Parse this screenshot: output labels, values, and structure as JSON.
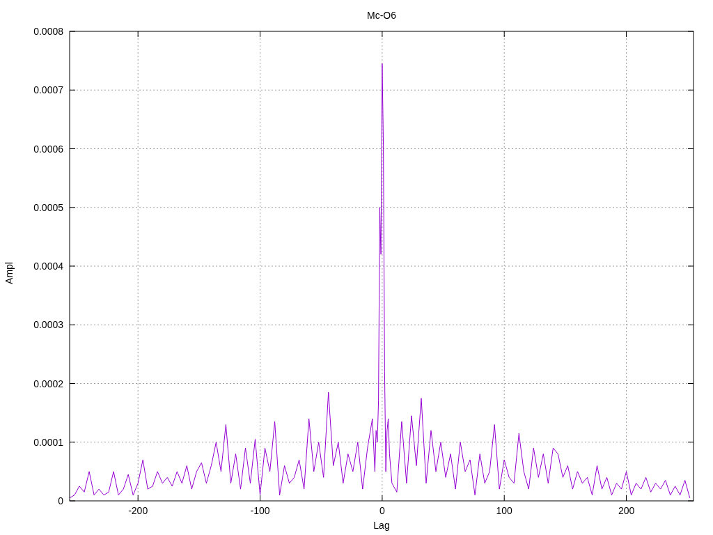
{
  "chart": {
    "chart_data": {
      "type": "line",
      "title": "Mc-O6",
      "xlabel": "Lag",
      "ylabel": "Ampl",
      "grid": true,
      "xlim": [
        -256,
        255
      ],
      "ylim": [
        0,
        0.0008
      ],
      "xticks": [
        -200,
        -100,
        0,
        100,
        200
      ],
      "yticks": [
        0,
        0.0001,
        0.0002,
        0.0003,
        0.0004,
        0.0005,
        0.0006,
        0.0007,
        0.0008
      ],
      "x": [
        -256,
        -252,
        -248,
        -244,
        -240,
        -236,
        -232,
        -228,
        -224,
        -220,
        -216,
        -212,
        -208,
        -204,
        -200,
        -196,
        -192,
        -188,
        -184,
        -180,
        -176,
        -172,
        -168,
        -164,
        -160,
        -156,
        -152,
        -148,
        -144,
        -140,
        -136,
        -132,
        -128,
        -124,
        -120,
        -116,
        -112,
        -108,
        -104,
        -100,
        -96,
        -92,
        -88,
        -84,
        -80,
        -76,
        -72,
        -68,
        -64,
        -60,
        -56,
        -52,
        -48,
        -44,
        -40,
        -36,
        -32,
        -28,
        -24,
        -20,
        -16,
        -12,
        -8,
        -6,
        -5,
        -4,
        -3,
        -2,
        -1,
        0,
        1,
        2,
        3,
        4,
        5,
        6,
        8,
        12,
        16,
        20,
        24,
        28,
        32,
        36,
        40,
        44,
        48,
        52,
        56,
        60,
        64,
        68,
        72,
        76,
        80,
        84,
        88,
        92,
        96,
        100,
        104,
        108,
        112,
        116,
        120,
        124,
        128,
        132,
        136,
        140,
        144,
        148,
        152,
        156,
        160,
        164,
        168,
        172,
        176,
        180,
        184,
        188,
        192,
        196,
        200,
        204,
        208,
        212,
        216,
        220,
        224,
        228,
        232,
        236,
        240,
        244,
        248,
        252
      ],
      "series": [
        {
          "color": "#9400d3",
          "values": [
            5e-06,
            1e-05,
            2.5e-05,
            1.5e-05,
            5e-05,
            1e-05,
            2e-05,
            1e-05,
            1.5e-05,
            5e-05,
            1e-05,
            2e-05,
            4.5e-05,
            1e-05,
            3e-05,
            7e-05,
            2e-05,
            2.5e-05,
            5e-05,
            3e-05,
            4e-05,
            2.5e-05,
            5e-05,
            3e-05,
            6e-05,
            2e-05,
            5e-05,
            6.5e-05,
            3e-05,
            6e-05,
            0.0001,
            5e-05,
            0.00013,
            3e-05,
            8e-05,
            2e-05,
            9e-05,
            3e-05,
            0.000105,
            1e-05,
            9e-05,
            5e-05,
            0.000135,
            1e-05,
            6e-05,
            3e-05,
            4e-05,
            7e-05,
            2e-05,
            0.00014,
            5e-05,
            0.0001,
            4e-05,
            0.000185,
            6e-05,
            0.0001,
            3e-05,
            8e-05,
            5e-05,
            0.0001,
            2e-05,
            9e-05,
            0.00014,
            5e-05,
            0.00012,
            0.0001,
            0.00017,
            0.0005,
            0.00042,
            0.000745,
            0.000605,
            0.00022,
            5e-05,
            0.00012,
            0.00014,
            8e-05,
            3e-05,
            1.5e-05,
            0.000135,
            3e-05,
            0.000145,
            6e-05,
            0.000175,
            3e-05,
            0.00012,
            5e-05,
            0.0001,
            4e-05,
            8e-05,
            2e-05,
            0.0001,
            5e-05,
            7e-05,
            1e-05,
            8e-05,
            3e-05,
            5e-05,
            0.00013,
            2e-05,
            7e-05,
            4e-05,
            3e-05,
            0.000115,
            5e-05,
            2e-05,
            9e-05,
            4e-05,
            8e-05,
            3e-05,
            9e-05,
            8e-05,
            4e-05,
            6e-05,
            2e-05,
            5e-05,
            3e-05,
            4e-05,
            1e-05,
            6e-05,
            2e-05,
            4e-05,
            1e-05,
            3e-05,
            2e-05,
            5e-05,
            1e-05,
            3e-05,
            2e-05,
            4e-05,
            1.5e-05,
            3e-05,
            2e-05,
            3.5e-05,
            1e-05,
            2.5e-05,
            1e-05,
            3.5e-05,
            5e-06
          ]
        }
      ]
    }
  }
}
